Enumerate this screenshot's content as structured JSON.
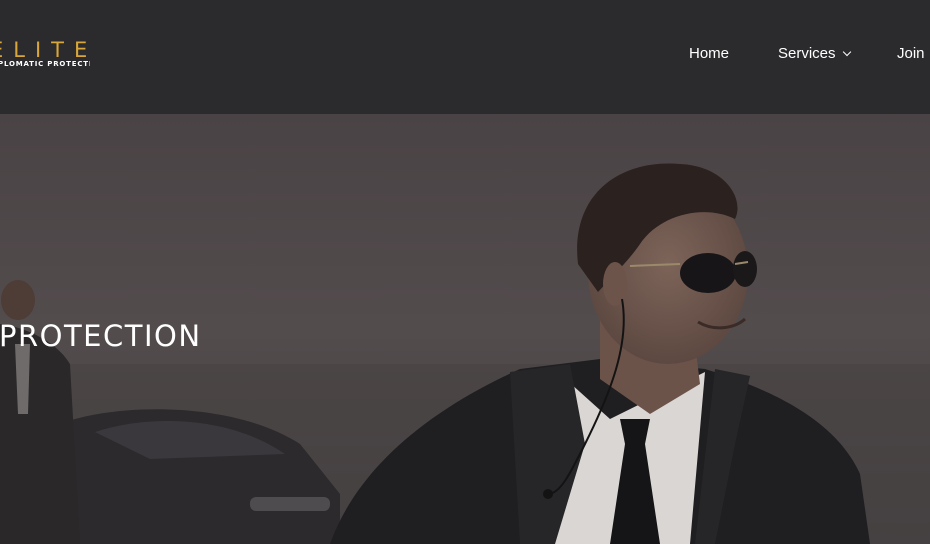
{
  "header": {
    "logo_word": "ELITE",
    "logo_tagline": "DIPLOMATIC PROTECTION"
  },
  "nav": {
    "items": [
      {
        "label": "Home"
      },
      {
        "label": "Services"
      },
      {
        "label": "Join"
      }
    ]
  },
  "hero": {
    "title": "PROTECTION"
  },
  "colors": {
    "header_bg": "#2b2a2c",
    "accent_gold": "#d8a63a"
  }
}
